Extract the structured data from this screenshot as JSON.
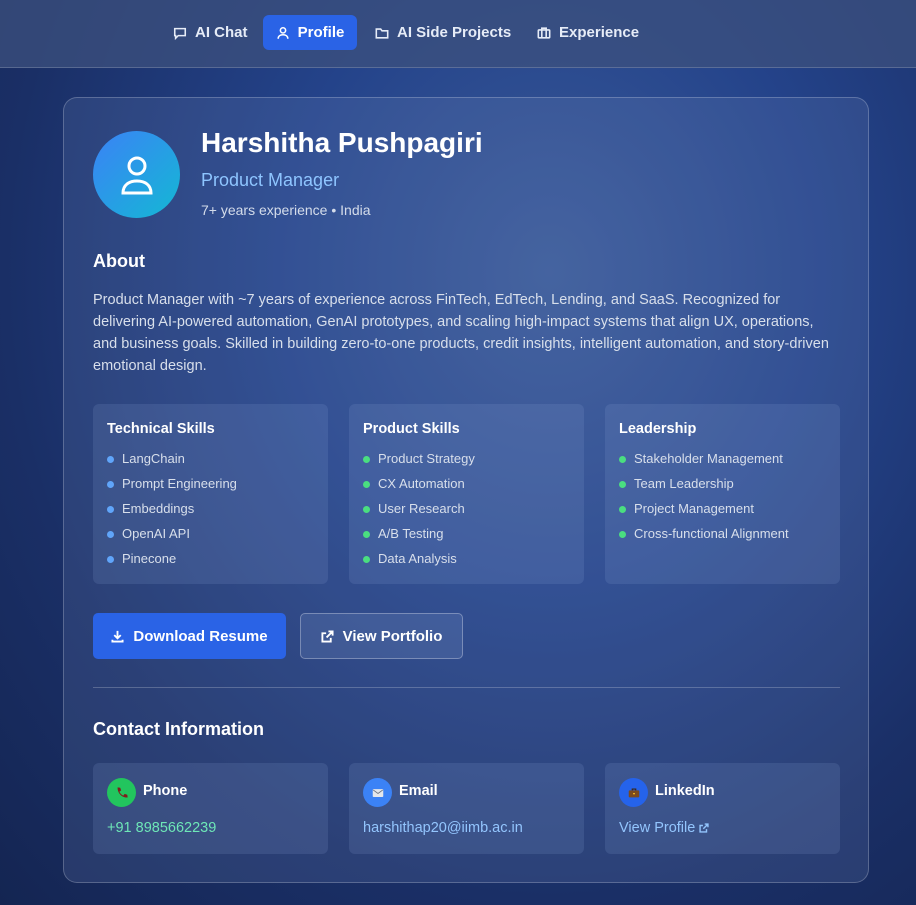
{
  "nav": {
    "items": [
      {
        "label": "AI Chat",
        "icon": "chat-bubble-icon"
      },
      {
        "label": "Profile",
        "icon": "user-icon",
        "active": true
      },
      {
        "label": "AI Side Projects",
        "icon": "folder-icon"
      },
      {
        "label": "Experience",
        "icon": "briefcase-icon"
      }
    ]
  },
  "profile": {
    "name": "Harshitha Pushpagiri",
    "role": "Product Manager",
    "meta": "7+ years experience • India"
  },
  "about": {
    "heading": "About",
    "text": "Product Manager with ~7 years of experience across FinTech, EdTech, Lending, and SaaS. Recognized for delivering AI-powered automation, GenAI prototypes, and scaling high-impact systems that align UX, operations, and business goals. Skilled in building zero-to-one products, credit insights, intelligent automation, and story-driven emotional design."
  },
  "skills": [
    {
      "title": "Technical Skills",
      "dot_color": "#60a5fa",
      "items": [
        "LangChain",
        "Prompt Engineering",
        "Embeddings",
        "OpenAI API",
        "Pinecone"
      ]
    },
    {
      "title": "Product Skills",
      "dot_color": "#4ade80",
      "items": [
        "Product Strategy",
        "CX Automation",
        "User Research",
        "A/B Testing",
        "Data Analysis"
      ]
    },
    {
      "title": "Leadership",
      "dot_color": "#4ade80",
      "items": [
        "Stakeholder Management",
        "Team Leadership",
        "Project Management",
        "Cross-functional Alignment"
      ]
    }
  ],
  "actions": {
    "download_label": "Download Resume",
    "portfolio_label": "View Portfolio"
  },
  "contact": {
    "heading": "Contact Information",
    "items": [
      {
        "label": "Phone",
        "value": "+91 8985662239",
        "icon": "phone-icon",
        "icon_bg": "#22c55e",
        "value_color": "#6ee7b7"
      },
      {
        "label": "Email",
        "value": "harshithap20@iimb.ac.in",
        "icon": "email-icon",
        "icon_bg": "#3b82f6",
        "value_color": "#93c5fd"
      },
      {
        "label": "LinkedIn",
        "value": "View Profile",
        "icon": "briefcase-icon",
        "icon_bg": "#2563eb",
        "value_color": "#93c5fd"
      }
    ]
  },
  "colors": {
    "accent": "#2a63e6",
    "role_text": "#8ec5ff"
  }
}
